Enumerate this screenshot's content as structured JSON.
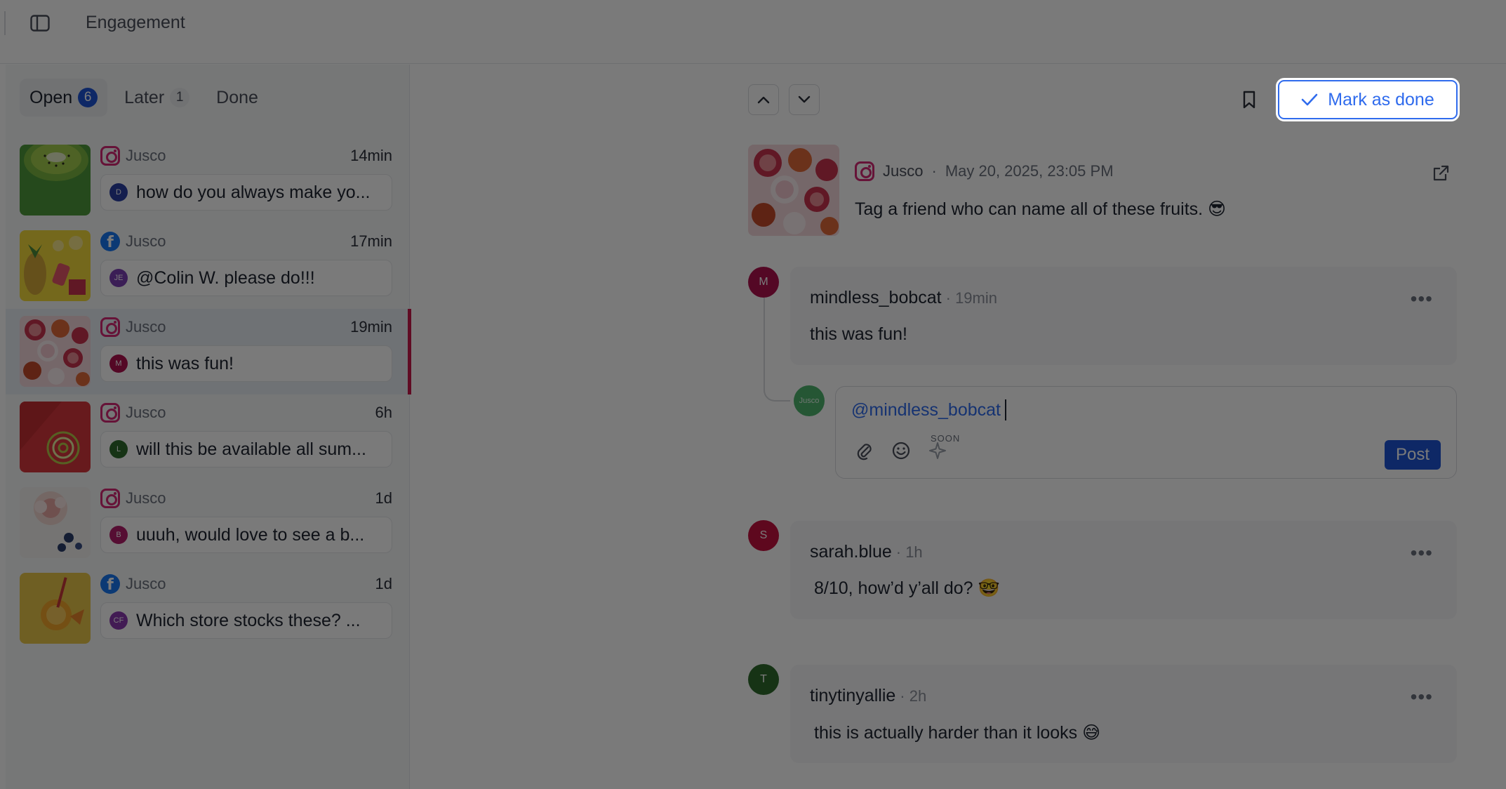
{
  "topbar": {
    "title": "Engagement",
    "sidebar_icon": "sidebar-toggle-icon"
  },
  "tabs": [
    {
      "label": "Open",
      "count": "6"
    },
    {
      "label": "Later",
      "count": "1"
    },
    {
      "label": "Done"
    }
  ],
  "conversations": [
    {
      "platform": "instagram",
      "account": "Jusco",
      "time": "14min",
      "avatar_initials": "D",
      "avatar_color": "#2a3fa3",
      "preview": "how do you always make yo..."
    },
    {
      "platform": "facebook",
      "account": "Jusco",
      "time": "17min",
      "avatar_initials": "JE",
      "avatar_color": "#7b3fb5",
      "preview": "@Colin W. please do!!!"
    },
    {
      "platform": "instagram",
      "account": "Jusco",
      "time": "19min",
      "avatar_initials": "M",
      "avatar_color": "#b0124f",
      "preview": "this was fun!"
    },
    {
      "platform": "instagram",
      "account": "Jusco",
      "time": "6h",
      "avatar_initials": "L",
      "avatar_color": "#2e6b2d",
      "preview": "will this be available all sum..."
    },
    {
      "platform": "instagram",
      "account": "Jusco",
      "time": "1d",
      "avatar_initials": "B",
      "avatar_color": "#b51e6b",
      "preview": "uuuh, would love to see a b..."
    },
    {
      "platform": "facebook",
      "account": "Jusco",
      "time": "1d",
      "avatar_initials": "CF",
      "avatar_color": "#8a3ab0",
      "preview": "Which store stocks these? ..."
    }
  ],
  "detail": {
    "mark_done_label": "Mark as done",
    "post": {
      "account": "Jusco",
      "date": "May 20, 2025, 23:05 PM",
      "text": "Tag a friend who can name all of these fruits. 😎"
    },
    "comments": [
      {
        "initials": "M",
        "color": "#b0124f",
        "author": "mindless_bobcat",
        "ago": "· 19min",
        "text": "this was fun!"
      },
      {
        "initials": "S",
        "color": "#c4123f",
        "author": "sarah.blue",
        "ago": "· 1h",
        "text": "8/10, how’d y’all do? 🤓"
      },
      {
        "initials": "T",
        "color": "#2e6b2d",
        "author": "tinytinyallie",
        "ago": "· 2h",
        "text": "this is actually harder than it looks 😅"
      }
    ],
    "reply": {
      "avatar_label": "Jusco",
      "value": "@mindless_bobcat",
      "soon_label": "SOON",
      "post_label": "Post"
    }
  },
  "colors": {
    "accent": "#1f55d6",
    "selected_bar": "#c9184a",
    "instagram": "#d62976",
    "facebook": "#1877f2"
  }
}
